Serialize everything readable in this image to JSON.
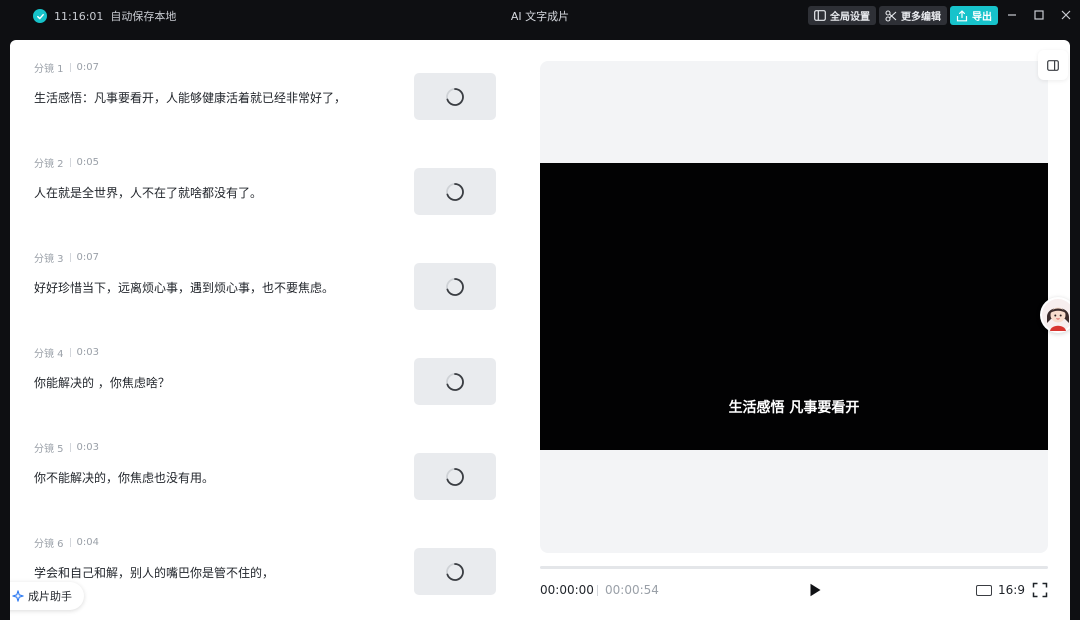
{
  "titlebar": {
    "save_time": "11:16:01",
    "save_status": "自动保存本地",
    "app_title": "AI 文字成片",
    "global_settings": "全局设置",
    "more_edit": "更多编辑",
    "export": "导出"
  },
  "shots": [
    {
      "label": "分镜 1",
      "duration": "0:07",
      "text": "生活感悟：凡事要看开，人能够健康活着就已经非常好了，"
    },
    {
      "label": "分镜 2",
      "duration": "0:05",
      "text": "人在就是全世界，人不在了就啥都没有了。"
    },
    {
      "label": "分镜 3",
      "duration": "0:07",
      "text": "好好珍惜当下，远离烦心事，遇到烦心事，也不要焦虑。"
    },
    {
      "label": "分镜 4",
      "duration": "0:03",
      "text": "你能解决的 ，你焦虑啥？"
    },
    {
      "label": "分镜 5",
      "duration": "0:03",
      "text": "你不能解决的，你焦虑也没有用。"
    },
    {
      "label": "分镜 6",
      "duration": "0:04",
      "text": "学会和自己和解，别人的嘴巴你是管不住的，"
    }
  ],
  "assistant": {
    "label": "成片助手"
  },
  "preview": {
    "subtitle": "生活感悟 凡事要看开"
  },
  "player": {
    "current_time": "00:00:00",
    "total_time": "00:00:54",
    "progress": 0,
    "aspect_ratio": "16:9"
  },
  "colors": {
    "accent": "#17c3cb",
    "video_bg": "#020203"
  }
}
